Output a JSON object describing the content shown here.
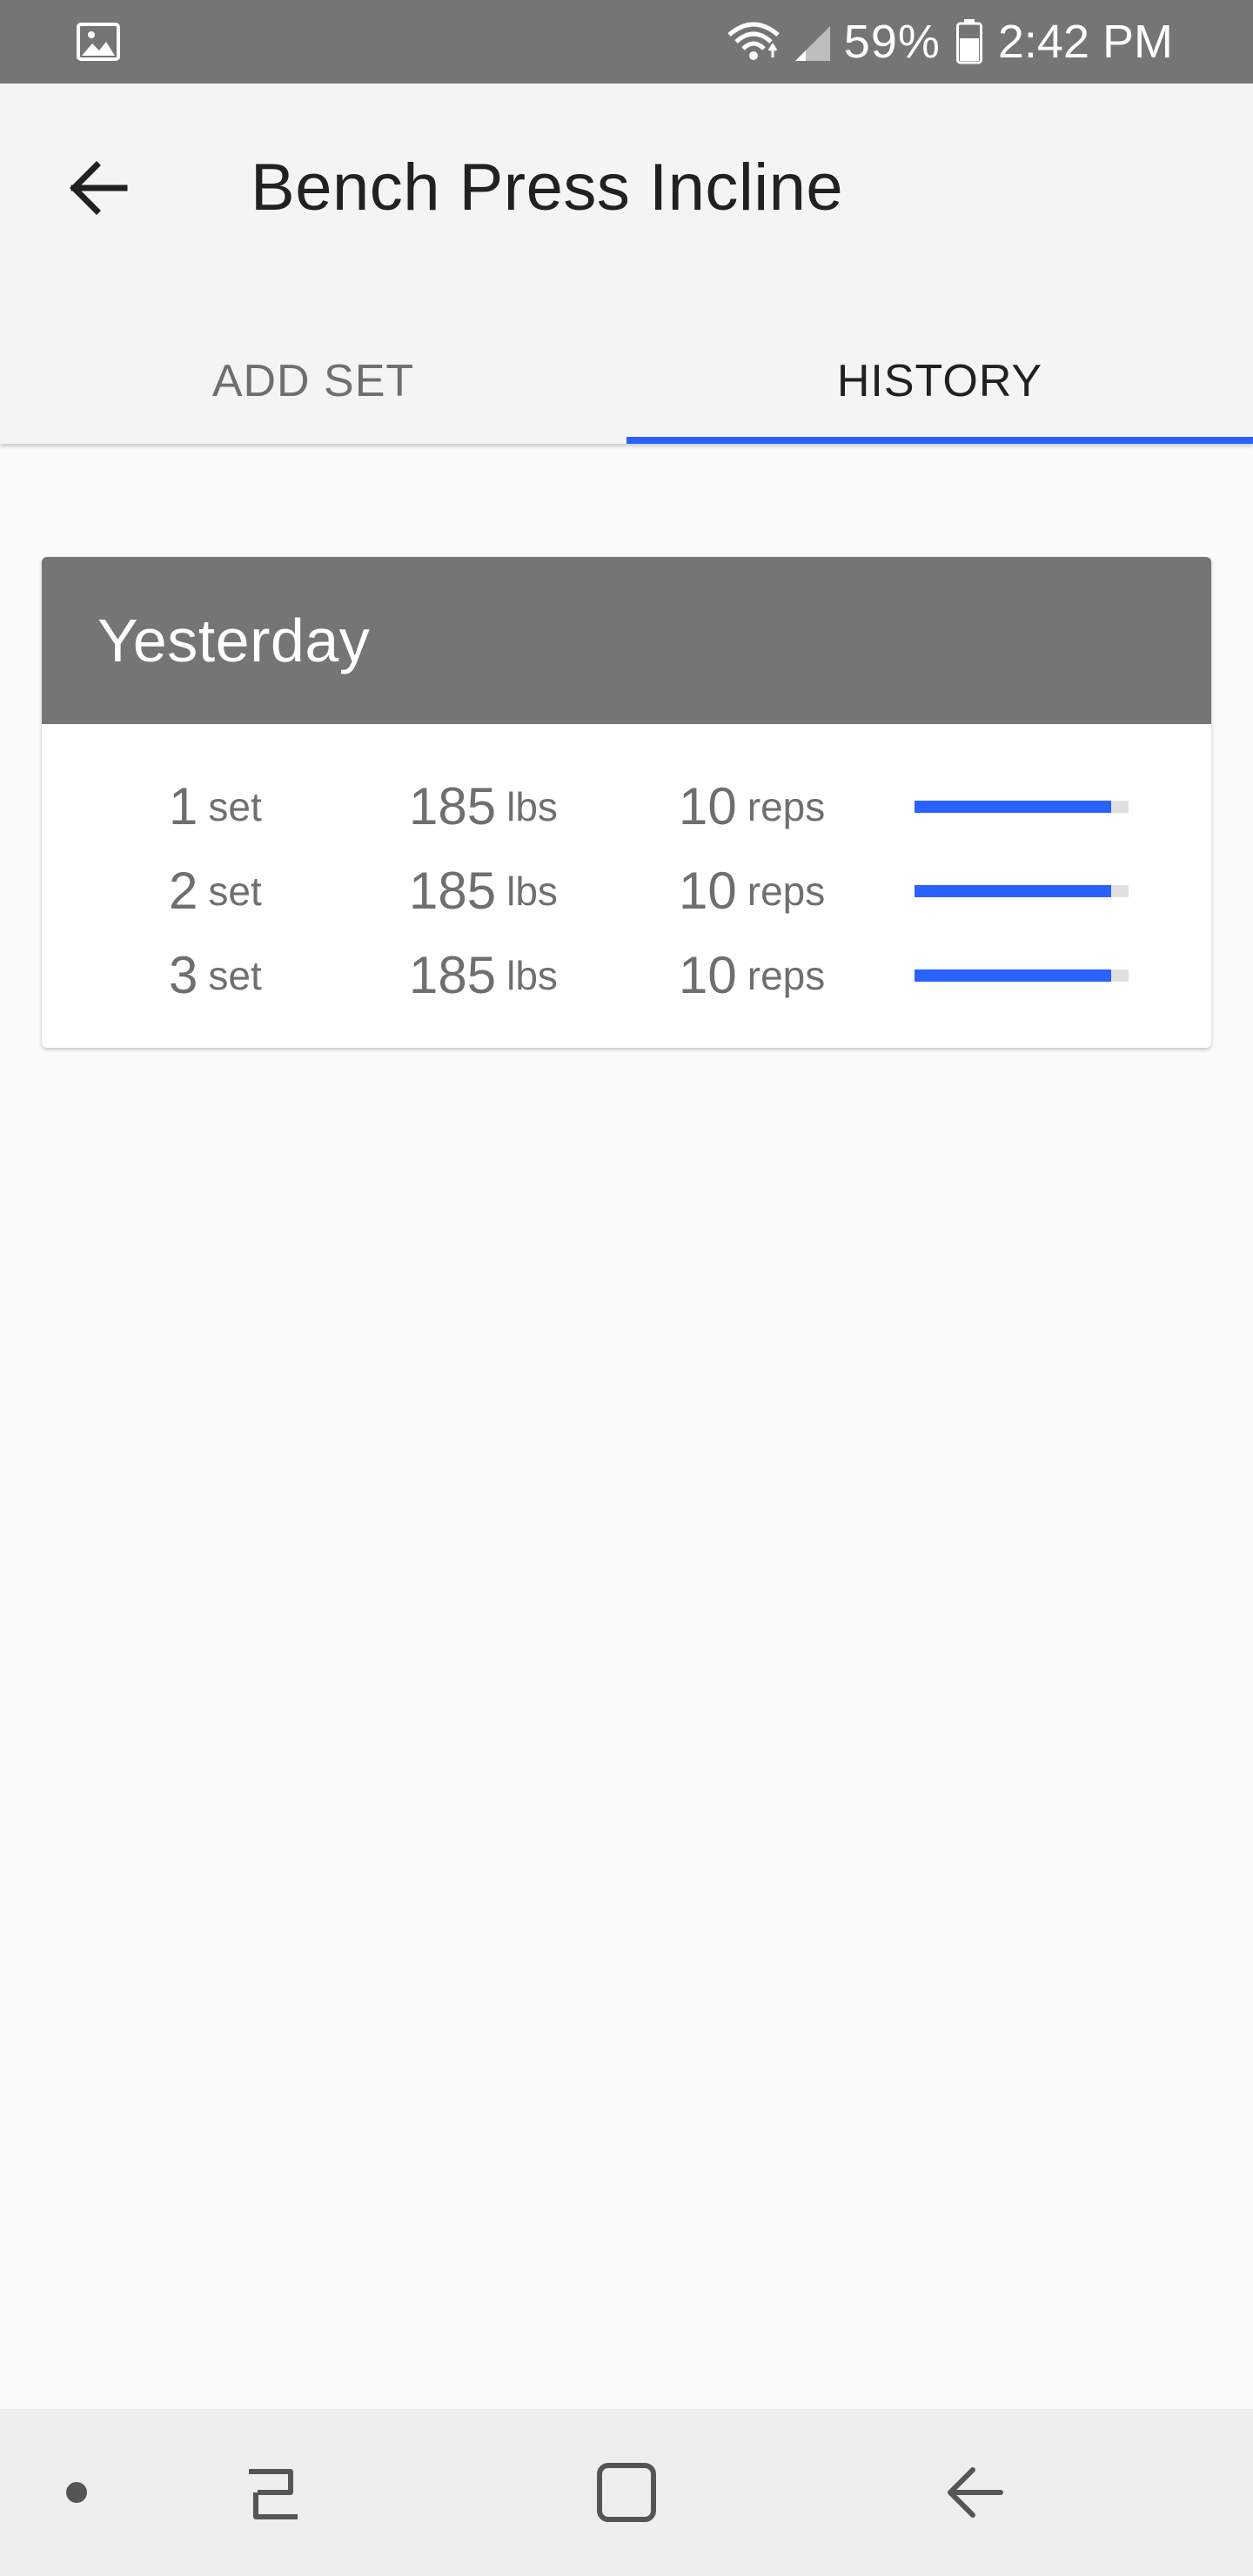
{
  "status_bar": {
    "battery_percent": "59%",
    "time": "2:42 PM",
    "icons": [
      "image-icon",
      "wifi-icon",
      "signal-icon",
      "battery-icon"
    ]
  },
  "app_bar": {
    "title": "Bench Press Incline",
    "back_icon": "arrow-left-icon"
  },
  "tabs": [
    {
      "label": "ADD SET",
      "active": false
    },
    {
      "label": "HISTORY",
      "active": true
    }
  ],
  "accent_color": "#2962ff",
  "history": {
    "header": "Yesterday",
    "sets": [
      {
        "set_number": "1",
        "set_unit": "set",
        "weight": "185",
        "weight_unit": "lbs",
        "reps": "10",
        "reps_unit": "reps",
        "progress": 0.92
      },
      {
        "set_number": "2",
        "set_unit": "set",
        "weight": "185",
        "weight_unit": "lbs",
        "reps": "10",
        "reps_unit": "reps",
        "progress": 0.92
      },
      {
        "set_number": "3",
        "set_unit": "set",
        "weight": "185",
        "weight_unit": "lbs",
        "reps": "10",
        "reps_unit": "reps",
        "progress": 0.92
      }
    ]
  },
  "nav_bar": {
    "icons": [
      "dot-icon",
      "recents-icon",
      "home-icon",
      "back-icon"
    ]
  }
}
